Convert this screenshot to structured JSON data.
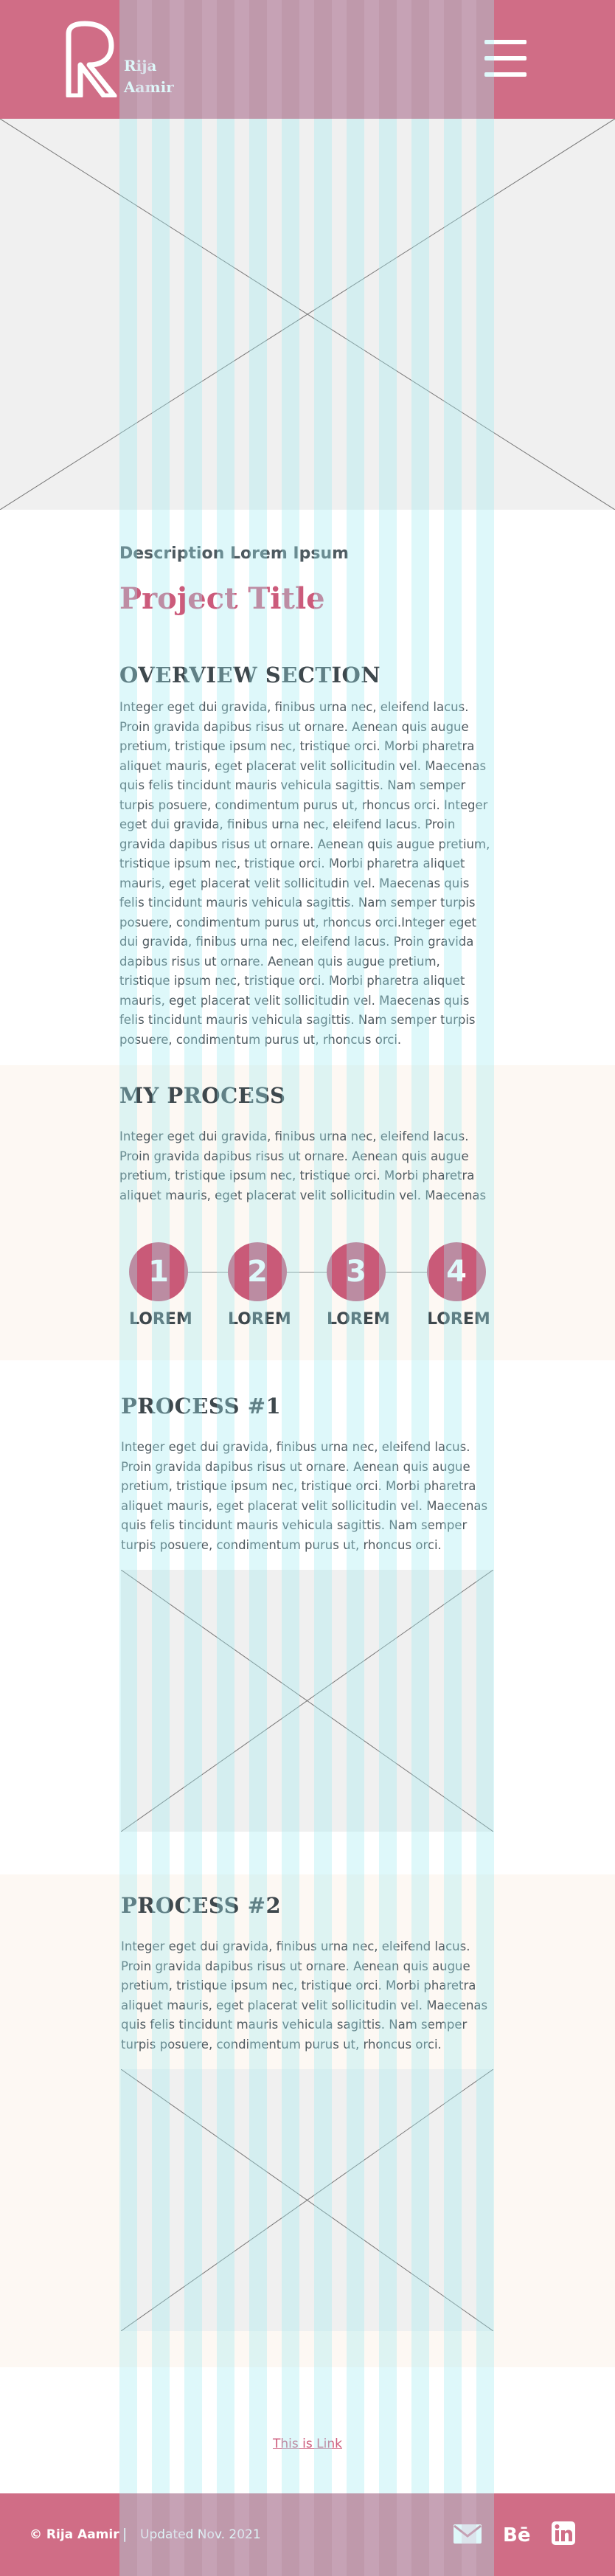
{
  "header": {
    "brand_line1": "Rija",
    "brand_line2": "Aamir",
    "brand_color": "#d06d86"
  },
  "hero_image": {
    "icon": "image-placeholder-icon"
  },
  "intro": {
    "description": "Description Lorem Ipsum",
    "project_title": "Project Title"
  },
  "overview": {
    "heading": "OVERVIEW SECTION",
    "lines": [
      "Integer eget dui gravida, finibus urna nec, eleifend lacus.",
      "Proin gravida dapibus risus ut ornare. Aenean quis augue",
      "pretium, tristique ipsum nec, tristique orci. Morbi pharetra",
      "aliquet mauris, eget placerat velit sollicitudin vel. Maecenas",
      "quis felis tincidunt mauris vehicula sagittis. Nam semper",
      "turpis posuere, condimentum purus ut, rhoncus orci. Integer",
      "eget dui gravida, finibus urna nec, eleifend lacus. Proin",
      "gravida dapibus risus ut ornare. Aenean quis augue pretium,",
      "tristique ipsum nec, tristique orci. Morbi pharetra aliquet",
      "mauris, eget placerat velit sollicitudin vel. Maecenas quis",
      "felis tincidunt mauris vehicula sagittis. Nam semper turpis",
      "posuere, condimentum purus ut, rhoncus orci.Integer eget",
      "dui gravida, finibus urna nec, eleifend lacus. Proin gravida",
      "dapibus risus ut ornare. Aenean quis augue pretium,",
      "tristique ipsum nec, tristique orci. Morbi pharetra aliquet",
      "mauris, eget placerat velit sollicitudin vel. Maecenas quis",
      "felis tincidunt mauris vehicula sagittis. Nam semper turpis",
      "posuere, condimentum purus ut, rhoncus orci."
    ]
  },
  "my_process": {
    "heading": "MY PROCESS",
    "lines": [
      "Integer eget dui gravida, finibus urna nec, eleifend lacus.",
      "Proin gravida dapibus risus ut ornare. Aenean quis augue",
      "pretium, tristique ipsum nec, tristique orci. Morbi pharetra",
      "aliquet mauris, eget placerat velit sollicitudin vel. Maecenas"
    ],
    "steps": [
      {
        "number": "1",
        "label": "LOREM"
      },
      {
        "number": "2",
        "label": "LOREM"
      },
      {
        "number": "3",
        "label": "LOREM"
      },
      {
        "number": "4",
        "label": "LOREM"
      }
    ],
    "step_color": "#c95a78"
  },
  "process1": {
    "heading": "PROCESS #1",
    "lines": [
      "Integer eget dui gravida, finibus urna nec, eleifend lacus.",
      "Proin gravida dapibus risus ut ornare. Aenean quis augue",
      "pretium, tristique ipsum nec, tristique orci. Morbi pharetra",
      "aliquet mauris, eget placerat velit sollicitudin vel. Maecenas",
      "quis felis tincidunt mauris vehicula sagittis. Nam semper",
      "turpis posuere, condimentum purus ut, rhoncus orci."
    ]
  },
  "process2": {
    "heading": "PROCESS #2",
    "lines": [
      "Integer eget dui gravida, finibus urna nec, eleifend lacus.",
      "Proin gravida dapibus risus ut ornare. Aenean quis augue",
      "pretium, tristique ipsum nec, tristique orci. Morbi pharetra",
      "aliquet mauris, eget placerat velit sollicitudin vel. Maecenas",
      "quis felis tincidunt mauris vehicula sagittis. Nam semper",
      "turpis posuere, condimentum purus ut, rhoncus orci."
    ]
  },
  "link": {
    "label": "This is Link"
  },
  "footer": {
    "copyright": "© Rija Aamir",
    "separator": "|",
    "updated": "Updated Nov. 2021",
    "icons": [
      "mail-icon",
      "behance-icon",
      "linkedin-icon"
    ]
  },
  "colors": {
    "accent": "#cc5b7b",
    "band_bg": "#fdf8f3",
    "placeholder_bg": "#f0f0f0"
  }
}
